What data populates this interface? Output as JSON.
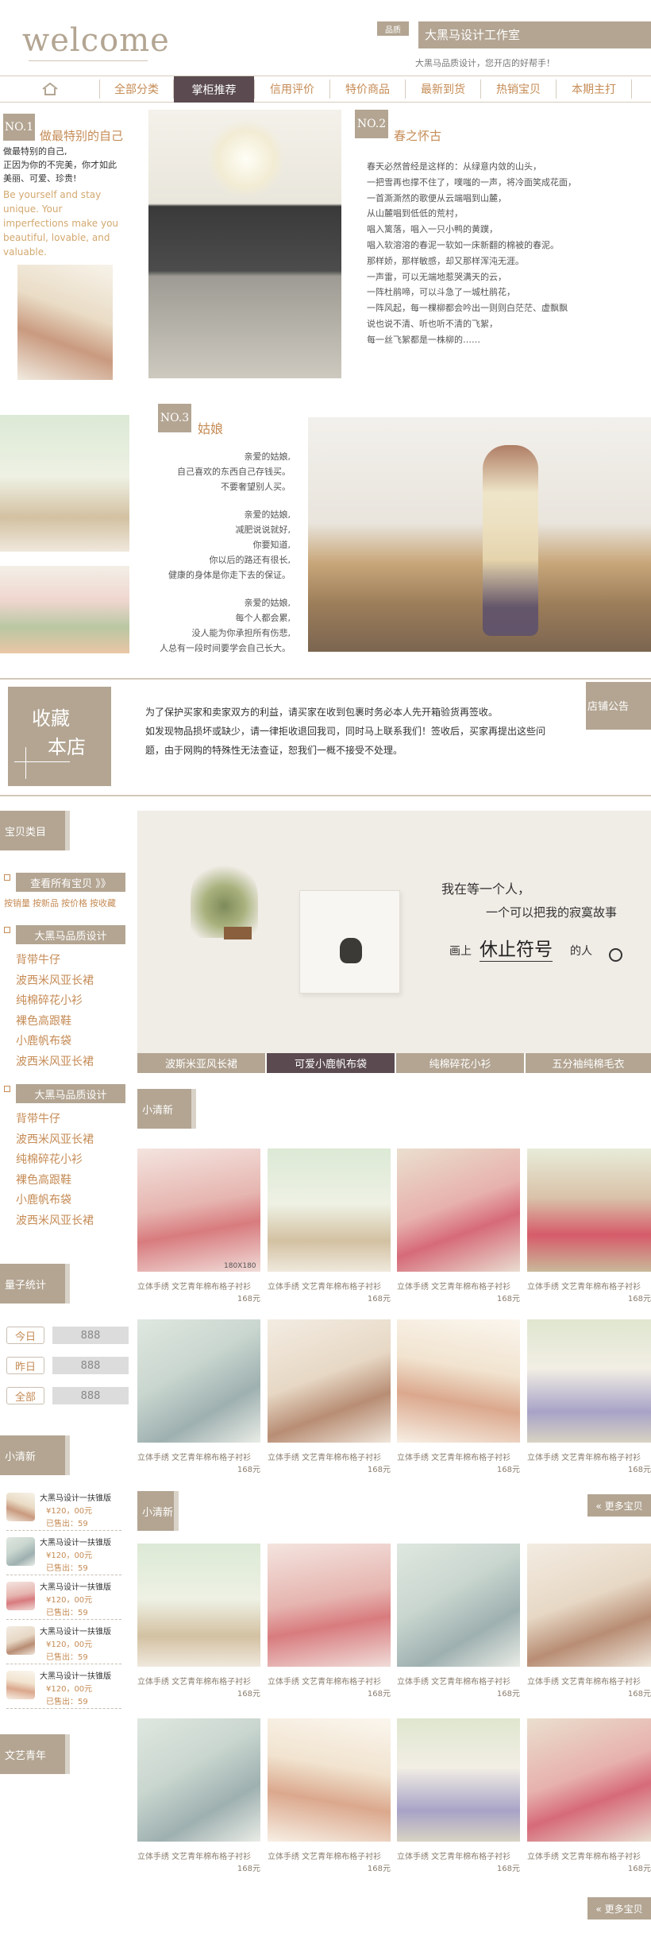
{
  "header": {
    "logo": "welcome",
    "badge": "品质",
    "shop_name": "大黑马设计工作室",
    "slogan": "大黑马品质设计，您开店的好帮手！"
  },
  "nav": {
    "home_icon": "home-icon",
    "items": [
      "全部分类",
      "掌柜推荐",
      "信用评价",
      "特价商品",
      "最新到货",
      "热销宝贝",
      "本期主打"
    ]
  },
  "no1": {
    "badge": "NO.1",
    "title": "做最特别的自己",
    "cn_lines": [
      "做最特别的自己,",
      "正因为你的不完美，你才如此",
      "美丽、可爱、珍贵!"
    ],
    "en_lines": [
      "Be yourself and stay",
      "unique. Your",
      "imperfections make you",
      "beautiful, lovable, and",
      "valuable."
    ]
  },
  "no2": {
    "badge": "NO.2",
    "title": "春之怀古",
    "lines": [
      "春天必然曾经是这样的：从绿意内敛的山头，",
      "一把雪再也撑不住了，噗嗤的一声，将冷面笑成花面，",
      "一首澌澌然的歌便从云端唱到山麓，",
      "从山麓唱到低低的荒村，",
      "唱入篱落，唱入一只小鸭的黄蹼，",
      "唱入软溶溶的春泥一软如一床新翻的棉被的春泥。",
      "那样娇，那样敏感，却又那样浑沌无涯。",
      "一声雷，可以无端地惹哭满天的云，",
      "一阵杜鹃啼，可以斗急了一城杜鹃花，",
      "一阵风起，每一棵柳都会吟出一则则白茫茫、虚飘飘",
      "说也说不清、听也听不清的飞絮，",
      "每一丝飞絮都是一株柳的……"
    ]
  },
  "no3": {
    "badge": "NO.3",
    "title": "姑娘",
    "stanzas": [
      [
        "亲爱的姑娘,",
        "自己喜欢的东西自己存钱买。",
        "不要奢望别人买。"
      ],
      [
        "亲爱的姑娘,",
        "减肥说说就好,",
        "你要知道,",
        "你以后的路还有很长,",
        "健康的身体是你走下去的保证。"
      ],
      [
        "亲爱的姑娘,",
        "每个人都会累,",
        "没人能为你承担所有伤悲,",
        "人总有一段时间要学会自己长大。"
      ]
    ]
  },
  "notice": {
    "fav_line1": "收藏",
    "fav_line2": "本店",
    "lines": [
      "为了保护买家和卖家双方的利益，请买家在收到包裹时务必本人先开箱验货再签收。",
      "如发现物品损坏或缺少，请一律拒收退回我司，同时马上联系我们！签收后，买家再提出这些问",
      "题，由于网购的特殊性无法查证，恕我们一概不接受不处理。"
    ],
    "label": "店铺公告"
  },
  "sidebar": {
    "cat_title": "宝贝类目",
    "view_all": "查看所有宝贝 》》",
    "sort_links": [
      "按销量",
      "按新品",
      "按价格",
      "按收藏"
    ],
    "group1_title": "大黑马品质设计",
    "group1_items": [
      "背带牛仔",
      "波西米风亚长裙",
      "纯棉碎花小衫",
      "裸色高跟鞋",
      "小鹿帆布袋",
      "波西米风亚长裙"
    ],
    "group2_title": "大黑马品质设计",
    "group2_items": [
      "背带牛仔",
      "波西米风亚长裙",
      "纯棉碎花小衫",
      "裸色高跟鞋",
      "小鹿帆布袋",
      "波西米风亚长裙"
    ],
    "stats_title": "量子统计",
    "stats": [
      {
        "label": "今日",
        "value": "888"
      },
      {
        "label": "昨日",
        "value": "888"
      },
      {
        "label": "全部",
        "value": "888"
      }
    ],
    "fresh_title": "小清新",
    "mini_items": [
      {
        "name": "大黑马设计一扶锥版",
        "price": "¥120，00元",
        "sold": "已售出：59"
      },
      {
        "name": "大黑马设计一扶锥版",
        "price": "¥120，00元",
        "sold": "已售出：59"
      },
      {
        "name": "大黑马设计一扶锥版",
        "price": "¥120，00元",
        "sold": "已售出：59"
      },
      {
        "name": "大黑马设计一扶锥版",
        "price": "¥120，00元",
        "sold": "已售出：59"
      },
      {
        "name": "大黑马设计一扶锥版",
        "price": "¥120，00元",
        "sold": "已售出：59"
      }
    ],
    "youth_title": "文艺青年"
  },
  "banner": {
    "line1": "我在等一个人，",
    "line2": "一个可以把我的寂寞故事",
    "line3a": "画上",
    "line3b": "休止符号",
    "line3c": "的人",
    "tabs": [
      "波斯米亚风长裙",
      "可爱小鹿帆布袋",
      "纯棉碎花小衫",
      "五分袖纯棉毛衣"
    ]
  },
  "products": {
    "section1_title": "小清新",
    "section2_title": "小清新",
    "more_label": "« 更多宝贝",
    "size_label": "180X180",
    "item_title": "立体手绣 文艺青年棉布格子衬衫",
    "item_price": "168元"
  },
  "colors": {
    "accent": "#b3a592",
    "link": "#c58b55",
    "active_tab": "#5b4b51"
  }
}
